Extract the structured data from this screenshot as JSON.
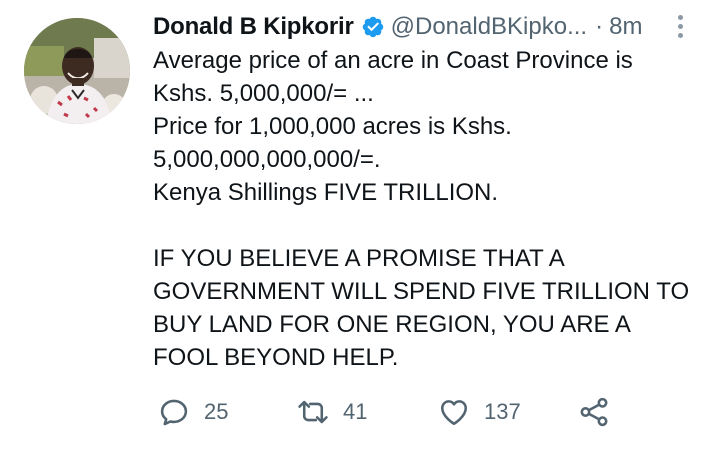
{
  "author": {
    "name": "Donald B Kipkorir",
    "handle": "@DonaldBKipko...",
    "separator": "·",
    "time": "8m"
  },
  "tweet": {
    "lines": [
      "Average price of an acre in Coast Province is",
      "Kshs. 5,000,000/= ...",
      "Price for 1,000,000 acres is Kshs.",
      "5,000,000,000,000/=.",
      "Kenya Shillings FIVE TRILLION.",
      "",
      "IF YOU BELIEVE A PROMISE THAT A",
      "GOVERNMENT WILL SPEND FIVE TRILLION TO",
      "BUY LAND FOR ONE REGION, YOU ARE A",
      "FOOL BEYOND HELP."
    ]
  },
  "actions": {
    "reply": {
      "icon": "reply-icon",
      "count": "25"
    },
    "retweet": {
      "icon": "retweet-icon",
      "count": "41"
    },
    "like": {
      "icon": "heart-icon",
      "count": "137"
    },
    "share": {
      "icon": "share-icon"
    }
  },
  "colors": {
    "text": "#0f1419",
    "secondary": "#536471",
    "verified": "#1d9bf0"
  }
}
